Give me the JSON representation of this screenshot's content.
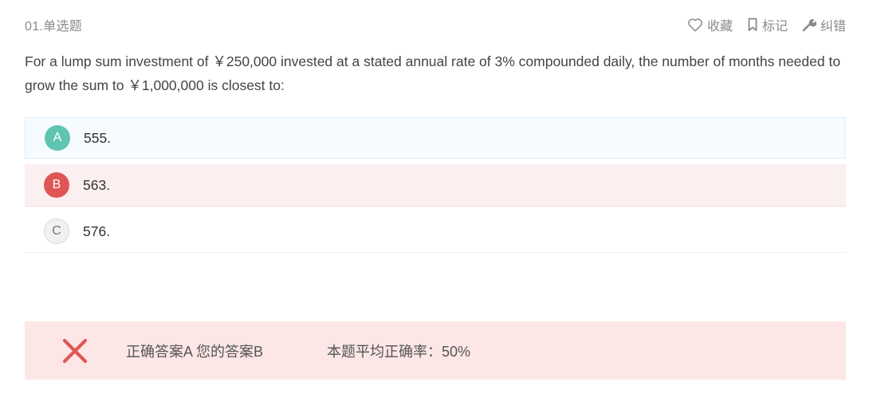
{
  "header": {
    "question_number": "01.单选题",
    "actions": {
      "favorite_label": "收藏",
      "mark_label": "标记",
      "report_label": "纠错"
    }
  },
  "question": {
    "text": "For a lump sum investment of ￥250,000 invested at a stated annual rate of 3% compounded daily, the number of months needed to grow the sum to ￥1,000,000 is closest to:"
  },
  "options": [
    {
      "letter": "A",
      "text": "555.",
      "state": "correct"
    },
    {
      "letter": "B",
      "text": "563.",
      "state": "selected-wrong"
    },
    {
      "letter": "C",
      "text": "576.",
      "state": "neutral"
    }
  ],
  "result": {
    "icon": "close-x-icon",
    "answers_text": "正确答案A 您的答案B",
    "accuracy_text": "本题平均正确率：50%"
  },
  "colors": {
    "correct": "#5fc4b1",
    "wrong": "#e05656",
    "wrong_bg": "#fcefef",
    "result_bg": "#fce6e6",
    "muted_text": "#8a8a8a"
  }
}
